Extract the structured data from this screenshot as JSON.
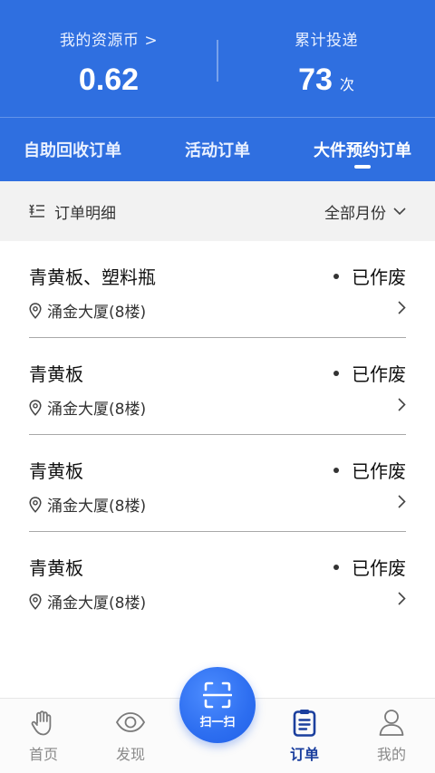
{
  "header": {
    "resource": {
      "label": "我的资源币 >",
      "value": "0.62"
    },
    "deliveries": {
      "label": "累计投递",
      "value": "73",
      "unit": "次"
    }
  },
  "tabs": [
    {
      "label": "自助回收订单",
      "active": false
    },
    {
      "label": "活动订单",
      "active": false
    },
    {
      "label": "大件预约订单",
      "active": true
    }
  ],
  "section": {
    "title": "订单明细",
    "filter_label": "全部月份",
    "icon": "list-icon"
  },
  "orders": [
    {
      "title": "青黄板、塑料瓶",
      "status": "已作废",
      "location": "涌金大厦(8楼)"
    },
    {
      "title": "青黄板",
      "status": "已作废",
      "location": "涌金大厦(8楼)"
    },
    {
      "title": "青黄板",
      "status": "已作废",
      "location": "涌金大厦(8楼)"
    },
    {
      "title": "青黄板",
      "status": "已作废",
      "location": "涌金大厦(8楼)"
    }
  ],
  "tabbar": {
    "home": "首页",
    "discover": "发现",
    "scan": "扫一扫",
    "orders": "订单",
    "mine": "我的"
  },
  "colors": {
    "brand_blue": "#2f6fe0",
    "active_tab_icon": "#1b3f9e"
  }
}
